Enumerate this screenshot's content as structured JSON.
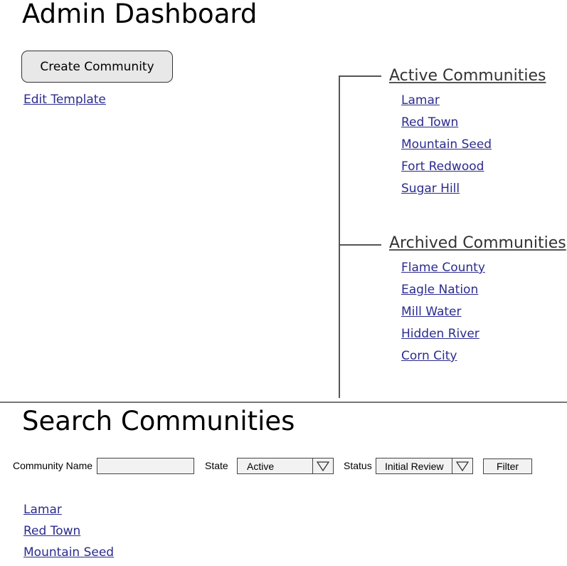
{
  "header": {
    "title": "Admin Dashboard"
  },
  "actions": {
    "create_label": "Create Community",
    "edit_template_label": "Edit Template"
  },
  "tree": {
    "active": {
      "heading": "Active Communities",
      "items": [
        "Lamar",
        "Red Town",
        "Mountain Seed",
        "Fort Redwood",
        "Sugar Hill"
      ]
    },
    "archived": {
      "heading": "Archived Communities",
      "items": [
        "Flame County",
        "Eagle Nation",
        "Mill Water",
        "Hidden River",
        "Corn City"
      ]
    }
  },
  "search": {
    "title": "Search Communities",
    "name_label": "Community Name",
    "name_value": "",
    "state_label": "State",
    "state_value": "Active",
    "status_label": "Status",
    "status_value": "Initial Review",
    "filter_label": "Filter",
    "results": [
      "Lamar",
      "Red Town",
      "Mountain Seed"
    ]
  },
  "icons": {
    "dropdown": "triangle-down-icon"
  }
}
